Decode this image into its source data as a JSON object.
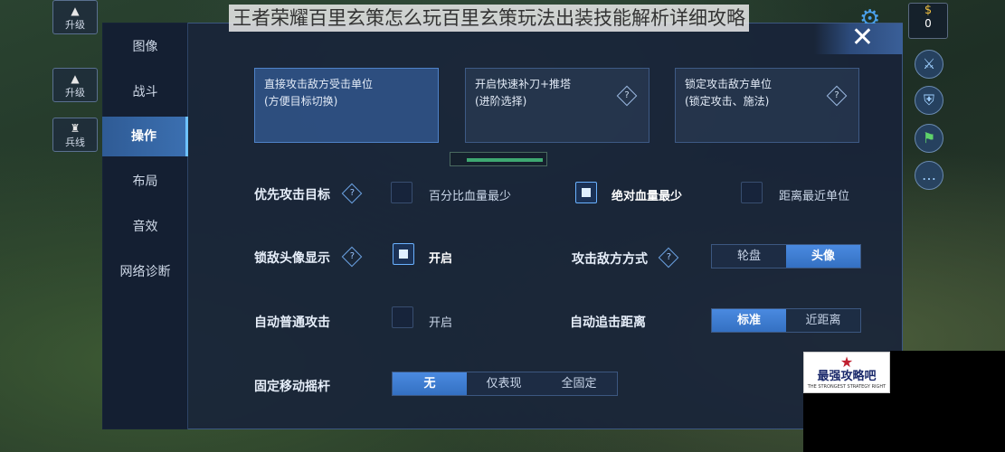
{
  "page_title": "王者荣耀百里玄策怎么玩百里玄策玩法出装技能解析详细攻略",
  "hud": {
    "upgrade_1": "升级",
    "upgrade_2": "升级",
    "minion": "兵线",
    "coins": "0"
  },
  "nav": {
    "items": [
      "图像",
      "战斗",
      "操作",
      "布局",
      "音效",
      "网络诊断"
    ],
    "active": "操作"
  },
  "mode_cards": [
    {
      "line1": "直接攻击敌方受击单位",
      "line2": "(方便目标切换)",
      "selected": true
    },
    {
      "line1": "开启快速补刀+推塔",
      "line2": "(进阶选择)",
      "selected": false
    },
    {
      "line1": "锁定攻击敌方单位",
      "line2": "(锁定攻击、施法)",
      "selected": false
    }
  ],
  "settings": {
    "priority_target": {
      "label": "优先攻击目标",
      "options": [
        "百分比血量最少",
        "绝对血量最少",
        "距离最近单位"
      ],
      "selected": "绝对血量最少"
    },
    "lock_avatar": {
      "label": "锁敌头像显示",
      "option": "开启",
      "checked": true
    },
    "attack_mode": {
      "label": "攻击敌方方式",
      "options": [
        "轮盘",
        "头像"
      ],
      "selected": "头像"
    },
    "auto_attack": {
      "label": "自动普通攻击",
      "option": "开启",
      "checked": false
    },
    "auto_chase": {
      "label": "自动追击距离",
      "options": [
        "标准",
        "近距离"
      ],
      "selected": "标准"
    },
    "fixed_joystick": {
      "label": "固定移动摇杆",
      "options": [
        "无",
        "仅表现",
        "全固定"
      ],
      "selected": "无"
    }
  },
  "watermark": {
    "name": "最强攻略吧",
    "sub": "THE STRONGEST STRATEGY RIGHT"
  },
  "icons": {
    "close": "close-icon",
    "gear": "gear-icon",
    "help": "question-diamond-icon"
  },
  "colors": {
    "panel_bg": "#18243a",
    "accent": "#3b6fb0",
    "active_segment": "#3f80d6"
  }
}
